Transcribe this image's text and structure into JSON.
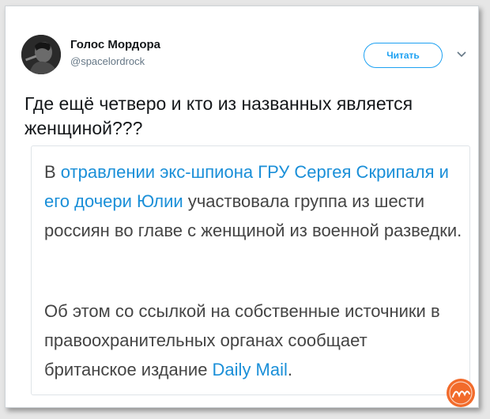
{
  "author": {
    "name": "Голос Мордора",
    "handle": "@spacelordrock",
    "avatar_icon": "avatar-photo"
  },
  "follow_button_label": "Читать",
  "menu_icon": "chevron-down-icon",
  "tweet_text": "Где ещё четверо и кто из названных является женщиной???",
  "quote": {
    "p1_lead": "В ",
    "p1_link": "отравлении экс-шпиона ГРУ Сергея Скрипаля и его дочери Юлии",
    "p1_rest": " участвовала группа из шести россиян во главе с женщиной из военной разведки.",
    "p2_lead": "Об этом со ссылкой на собственные источники в правоохранительных органах сообщает британское издание ",
    "p2_link": "Daily Mail",
    "p2_end": "."
  },
  "watermark": "logo-watermark",
  "colors": {
    "accent": "#1da1f2",
    "link": "#1a8fd8",
    "text": "#14171a",
    "muted": "#657786",
    "watermark": "#f26b2b"
  }
}
